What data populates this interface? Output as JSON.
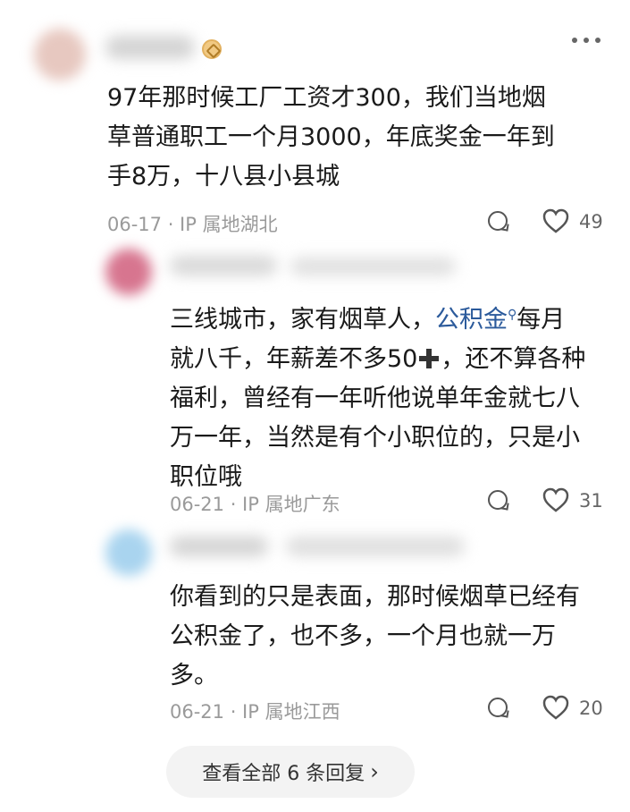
{
  "comments": [
    {
      "text_lines": [
        "97年那时候工厂工资才300，我们当地烟",
        "草普通职工一个月3000，年底奖金一年到",
        "手8万，十八县小县城"
      ],
      "meta": "06-17 · IP 属地湖北",
      "likes": "49"
    },
    {
      "text_lines": [
        "",
        "就八千，年薪差不多50",
        "福利，曾经有一年听他说单年金就七八",
        "万一年，当然是有个小职位的，只是小",
        "职位哦"
      ],
      "line1_prefix": "三线城市，家有烟草人，",
      "line1_link": "公积金",
      "line1_suffix": "每月",
      "line2_suffix": "，还不算各种",
      "meta": "06-21 · IP 属地广东",
      "likes": "31"
    },
    {
      "text_lines": [
        "你看到的只是表面，那时候烟草已经有",
        "公积金了，也不多，一个月也就一万",
        "多。"
      ],
      "meta": "06-21 · IP 属地江西",
      "likes": "20"
    }
  ],
  "view_all_label": "查看全部 6 条回复",
  "icons": {
    "more": "more-dots-icon",
    "reply": "comment-bubble-icon",
    "like": "heart-icon",
    "badge": "level-badge-icon",
    "search": "search-icon",
    "chevron": "chevron-right-icon",
    "plus": "plus-icon"
  },
  "colors": {
    "link": "#2b5a9b",
    "meta": "#9a9a9a"
  }
}
